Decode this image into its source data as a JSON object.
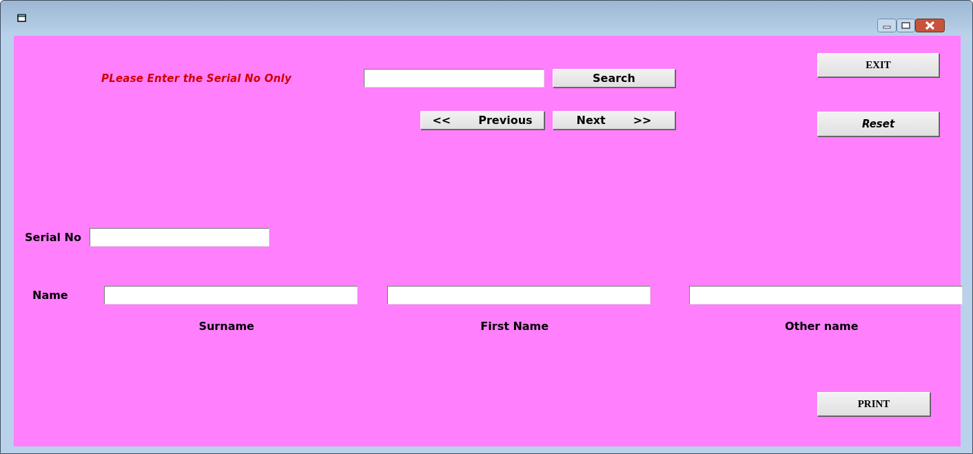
{
  "search": {
    "prompt": "PLease Enter the Serial No Only",
    "button": "Search"
  },
  "navigation": {
    "previous": {
      "arrow": "<<",
      "label": "Previous"
    },
    "next": {
      "label": "Next",
      "arrow": ">>"
    }
  },
  "actions": {
    "exit": "EXIT",
    "reset": "Reset",
    "print": "PRINT"
  },
  "serial": {
    "label": "Serial No"
  },
  "name": {
    "label": "Name",
    "parts": [
      {
        "caption": "Surname"
      },
      {
        "caption": "First Name"
      },
      {
        "caption": "Other name"
      }
    ]
  }
}
